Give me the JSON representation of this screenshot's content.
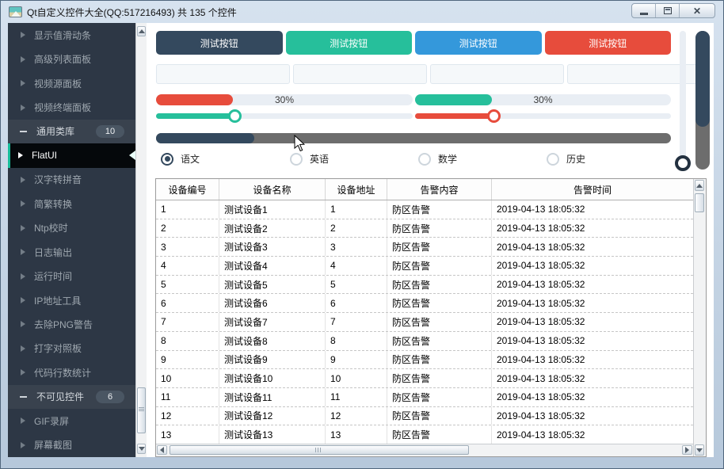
{
  "window": {
    "title": "Qt自定义控件大全(QQ:517216493) 共 135 个控件",
    "controls": {
      "minimize": "minimize",
      "maximize": "maximize",
      "close": "close"
    }
  },
  "sidebar": {
    "items": [
      {
        "label": "显示值滑动条",
        "type": "item"
      },
      {
        "label": "高级列表面板",
        "type": "item"
      },
      {
        "label": "视频源面板",
        "type": "item"
      },
      {
        "label": "视频终端面板",
        "type": "item"
      },
      {
        "label": "通用类库",
        "type": "group",
        "badge": "10"
      },
      {
        "label": "FlatUI",
        "type": "item",
        "selected": true
      },
      {
        "label": "汉字转拼音",
        "type": "item"
      },
      {
        "label": "简繁转换",
        "type": "item"
      },
      {
        "label": "Ntp校时",
        "type": "item"
      },
      {
        "label": "日志输出",
        "type": "item"
      },
      {
        "label": "运行时间",
        "type": "item"
      },
      {
        "label": "IP地址工具",
        "type": "item"
      },
      {
        "label": "去除PNG警告",
        "type": "item"
      },
      {
        "label": "打字对照板",
        "type": "item"
      },
      {
        "label": "代码行数统计",
        "type": "item"
      },
      {
        "label": "不可见控件",
        "type": "group",
        "badge": "6"
      },
      {
        "label": "GIF录屏",
        "type": "item"
      },
      {
        "label": "屏幕截图",
        "type": "item"
      }
    ]
  },
  "main": {
    "buttons": [
      {
        "label": "测试按钮",
        "color": "#34495e"
      },
      {
        "label": "测试按钮",
        "color": "#26bf9b"
      },
      {
        "label": "测试按钮",
        "color": "#3498db"
      },
      {
        "label": "测试按钮",
        "color": "#e74c3c"
      }
    ],
    "inputs": [
      {
        "value": "",
        "placeholder": ""
      },
      {
        "value": "",
        "placeholder": ""
      },
      {
        "value": "",
        "placeholder": ""
      },
      {
        "value": "",
        "placeholder": ""
      }
    ],
    "progress_bars": [
      {
        "label": "30%",
        "percent": 30,
        "color": "#e74c3c"
      },
      {
        "label": "30%",
        "percent": 30,
        "color": "#26bf9b"
      }
    ],
    "sliders": [
      {
        "percent": 31,
        "color": "#26bf9b"
      },
      {
        "percent": 31,
        "color": "#e74c3c"
      }
    ],
    "scrollbar_demo": {
      "filled_percent": 19,
      "filled_color": "#34495e",
      "track_color": "#6d6d6d"
    },
    "vertical_slider": {
      "percent": 100
    },
    "vertical_scrollbar_demo": {
      "filled_percent": 69,
      "filled_color": "#34495e",
      "track_color": "#6d6d6d"
    },
    "radios": [
      {
        "label": "语文",
        "selected": true
      },
      {
        "label": "英语",
        "selected": false
      },
      {
        "label": "数学",
        "selected": false
      },
      {
        "label": "历史",
        "selected": false
      }
    ]
  },
  "table": {
    "headers": [
      "设备编号",
      "设备名称",
      "设备地址",
      "告警内容",
      "告警时间"
    ],
    "rows": [
      [
        "1",
        "测试设备1",
        "1",
        "防区告警",
        "2019-04-13 18:05:32"
      ],
      [
        "2",
        "测试设备2",
        "2",
        "防区告警",
        "2019-04-13 18:05:32"
      ],
      [
        "3",
        "测试设备3",
        "3",
        "防区告警",
        "2019-04-13 18:05:32"
      ],
      [
        "4",
        "测试设备4",
        "4",
        "防区告警",
        "2019-04-13 18:05:32"
      ],
      [
        "5",
        "测试设备5",
        "5",
        "防区告警",
        "2019-04-13 18:05:32"
      ],
      [
        "6",
        "测试设备6",
        "6",
        "防区告警",
        "2019-04-13 18:05:32"
      ],
      [
        "7",
        "测试设备7",
        "7",
        "防区告警",
        "2019-04-13 18:05:32"
      ],
      [
        "8",
        "测试设备8",
        "8",
        "防区告警",
        "2019-04-13 18:05:32"
      ],
      [
        "9",
        "测试设备9",
        "9",
        "防区告警",
        "2019-04-13 18:05:32"
      ],
      [
        "10",
        "测试设备10",
        "10",
        "防区告警",
        "2019-04-13 18:05:32"
      ],
      [
        "11",
        "测试设备11",
        "11",
        "防区告警",
        "2019-04-13 18:05:32"
      ],
      [
        "12",
        "测试设备12",
        "12",
        "防区告警",
        "2019-04-13 18:05:32"
      ],
      [
        "13",
        "测试设备13",
        "13",
        "防区告警",
        "2019-04-13 18:05:32"
      ]
    ]
  }
}
